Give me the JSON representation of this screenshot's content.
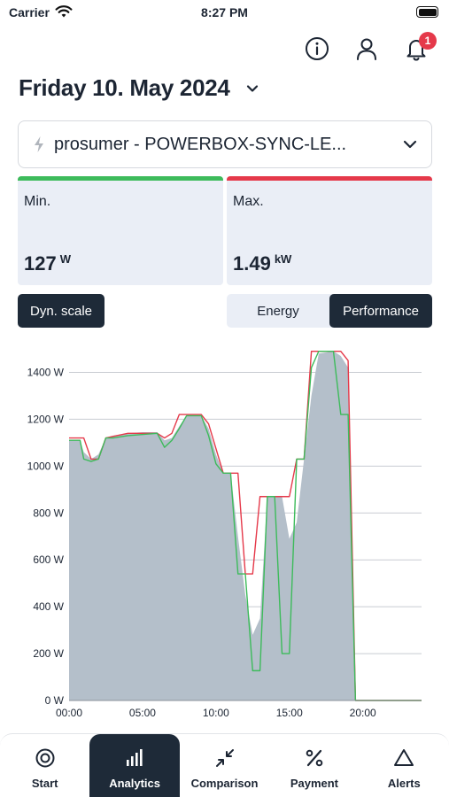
{
  "status_bar": {
    "carrier": "Carrier",
    "time": "8:27 PM"
  },
  "header": {
    "notification_count": "1",
    "date_title": "Friday 10. May 2024"
  },
  "device_select": {
    "label": "prosumer - POWERBOX-SYNC-LE..."
  },
  "stats": {
    "min": {
      "title": "Min.",
      "value": "127",
      "unit": "W",
      "accent": "#3dbb5b"
    },
    "max": {
      "title": "Max.",
      "value": "1.49",
      "unit": "kW",
      "accent": "#e5394a"
    }
  },
  "controls": {
    "dyn_scale": "Dyn. scale",
    "toggle": [
      {
        "label": "Energy",
        "active": false
      },
      {
        "label": "Performance",
        "active": true
      }
    ]
  },
  "chart_data": {
    "type": "area",
    "ylim": [
      0,
      1500
    ],
    "xlim": [
      0,
      24
    ],
    "y_ticks": [
      {
        "v": 0,
        "label": "0 W"
      },
      {
        "v": 200,
        "label": "200 W"
      },
      {
        "v": 400,
        "label": "400 W"
      },
      {
        "v": 600,
        "label": "600 W"
      },
      {
        "v": 800,
        "label": "800 W"
      },
      {
        "v": 1000,
        "label": "1000 W"
      },
      {
        "v": 1200,
        "label": "1200 W"
      },
      {
        "v": 1400,
        "label": "1400 W"
      }
    ],
    "x_ticks": [
      {
        "v": 0,
        "label": "00:00"
      },
      {
        "v": 5,
        "label": "05:00"
      },
      {
        "v": 10,
        "label": "10:00"
      },
      {
        "v": 15,
        "label": "15:00"
      },
      {
        "v": 20,
        "label": "20:00"
      }
    ],
    "colors": {
      "area": "#b4bfca",
      "max_line": "#e5394a",
      "min_line": "#3dbb5b",
      "grid": "#c8ccd2"
    },
    "series": [
      {
        "role": "area",
        "values": [
          [
            0,
            1110
          ],
          [
            0.75,
            1110
          ],
          [
            1,
            1060
          ],
          [
            1.5,
            1030
          ],
          [
            2,
            1050
          ],
          [
            2.5,
            1120
          ],
          [
            3,
            1130
          ],
          [
            4,
            1140
          ],
          [
            5,
            1145
          ],
          [
            6,
            1145
          ],
          [
            6.5,
            1110
          ],
          [
            7,
            1120
          ],
          [
            7.5,
            1170
          ],
          [
            8,
            1215
          ],
          [
            9,
            1215
          ],
          [
            9.5,
            1160
          ],
          [
            10,
            1050
          ],
          [
            10.5,
            970
          ],
          [
            11,
            970
          ],
          [
            11.5,
            700
          ],
          [
            12,
            450
          ],
          [
            12.5,
            280
          ],
          [
            13,
            350
          ],
          [
            13.5,
            870
          ],
          [
            14,
            870
          ],
          [
            14.5,
            870
          ],
          [
            15,
            690
          ],
          [
            15.5,
            760
          ],
          [
            16,
            1030
          ],
          [
            16.5,
            1300
          ],
          [
            17,
            1480
          ],
          [
            18,
            1490
          ],
          [
            18.5,
            1470
          ],
          [
            19,
            1420
          ],
          [
            19.5,
            0
          ],
          [
            24,
            0
          ]
        ]
      },
      {
        "role": "max",
        "values": [
          [
            0,
            1120
          ],
          [
            1,
            1120
          ],
          [
            1.5,
            1030
          ],
          [
            2,
            1030
          ],
          [
            2.5,
            1120
          ],
          [
            4,
            1140
          ],
          [
            6,
            1140
          ],
          [
            6.5,
            1120
          ],
          [
            7,
            1140
          ],
          [
            7.5,
            1220
          ],
          [
            9,
            1220
          ],
          [
            9.5,
            1180
          ],
          [
            10.5,
            970
          ],
          [
            11.5,
            970
          ],
          [
            12,
            540
          ],
          [
            12.5,
            540
          ],
          [
            13,
            870
          ],
          [
            15,
            870
          ],
          [
            15.5,
            1030
          ],
          [
            16,
            1030
          ],
          [
            16.5,
            1490
          ],
          [
            18.5,
            1490
          ],
          [
            19,
            1450
          ],
          [
            19.5,
            0
          ],
          [
            24,
            0
          ]
        ]
      },
      {
        "role": "min",
        "values": [
          [
            0,
            1110
          ],
          [
            0.75,
            1110
          ],
          [
            1,
            1030
          ],
          [
            1.5,
            1020
          ],
          [
            2,
            1030
          ],
          [
            2.5,
            1120
          ],
          [
            3,
            1120
          ],
          [
            4,
            1130
          ],
          [
            6,
            1140
          ],
          [
            6.5,
            1080
          ],
          [
            7,
            1110
          ],
          [
            7.5,
            1160
          ],
          [
            8,
            1215
          ],
          [
            9,
            1215
          ],
          [
            9.5,
            1130
          ],
          [
            10,
            1010
          ],
          [
            10.5,
            970
          ],
          [
            11,
            970
          ],
          [
            11.5,
            540
          ],
          [
            12,
            540
          ],
          [
            12.5,
            127
          ],
          [
            13,
            127
          ],
          [
            13.5,
            870
          ],
          [
            14,
            870
          ],
          [
            14.5,
            200
          ],
          [
            15,
            200
          ],
          [
            15.5,
            1030
          ],
          [
            16,
            1030
          ],
          [
            16.5,
            1420
          ],
          [
            17,
            1490
          ],
          [
            18,
            1490
          ],
          [
            18.5,
            1220
          ],
          [
            19,
            1220
          ],
          [
            19.5,
            0
          ],
          [
            24,
            0
          ]
        ]
      }
    ]
  },
  "tabs": [
    {
      "label": "Start",
      "icon": "start-icon",
      "active": false
    },
    {
      "label": "Analytics",
      "icon": "analytics-icon",
      "active": true
    },
    {
      "label": "Comparison",
      "icon": "comparison-icon",
      "active": false
    },
    {
      "label": "Payment",
      "icon": "percent-icon",
      "active": false
    },
    {
      "label": "Alerts",
      "icon": "alert-triangle-icon",
      "active": false
    }
  ]
}
